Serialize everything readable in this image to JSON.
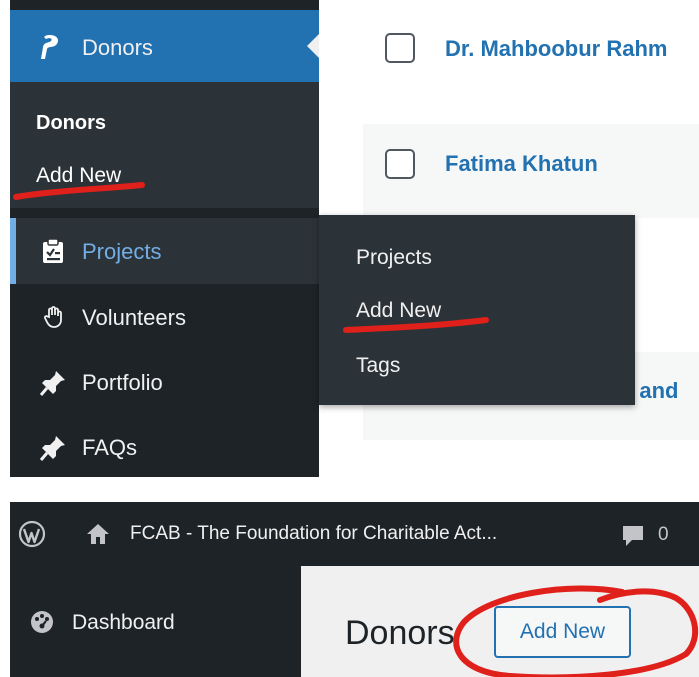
{
  "top_panel": {
    "sidebar": {
      "donors_menu": {
        "label": "Donors",
        "icon": "donors-icon"
      },
      "donors_submenu": {
        "title": "Donors",
        "add_new": "Add New"
      },
      "items": [
        {
          "label": "Projects",
          "icon": "clipboard-icon",
          "active": true
        },
        {
          "label": "Volunteers",
          "icon": "hand-icon"
        },
        {
          "label": "Portfolio",
          "icon": "pin-icon"
        },
        {
          "label": "FAQs",
          "icon": "pin-icon"
        }
      ]
    },
    "projects_flyout": {
      "items": [
        "Projects",
        "Add New",
        "Tags"
      ]
    },
    "donor_list": {
      "rows": [
        {
          "name": "Dr. Mahboobur Rahm"
        },
        {
          "name": "Fatima Khatun"
        },
        {
          "name": "a and"
        }
      ]
    }
  },
  "bottom_panel": {
    "adminbar": {
      "site_name": "FCAB - The Foundation for Charitable Act...",
      "comments_count": "0",
      "icons": [
        "wordpress-logo-icon",
        "home-icon",
        "comment-icon"
      ]
    },
    "sidebar": {
      "dashboard_label": "Dashboard",
      "icon": "palette-icon"
    },
    "page": {
      "title": "Donors",
      "add_new_button": "Add New"
    }
  },
  "colors": {
    "admin_dark": "#1d2327",
    "submenu_dark": "#2c3338",
    "active_blue": "#2271b1",
    "link_blue": "#2271b1",
    "annotation_red": "#e0201b"
  }
}
